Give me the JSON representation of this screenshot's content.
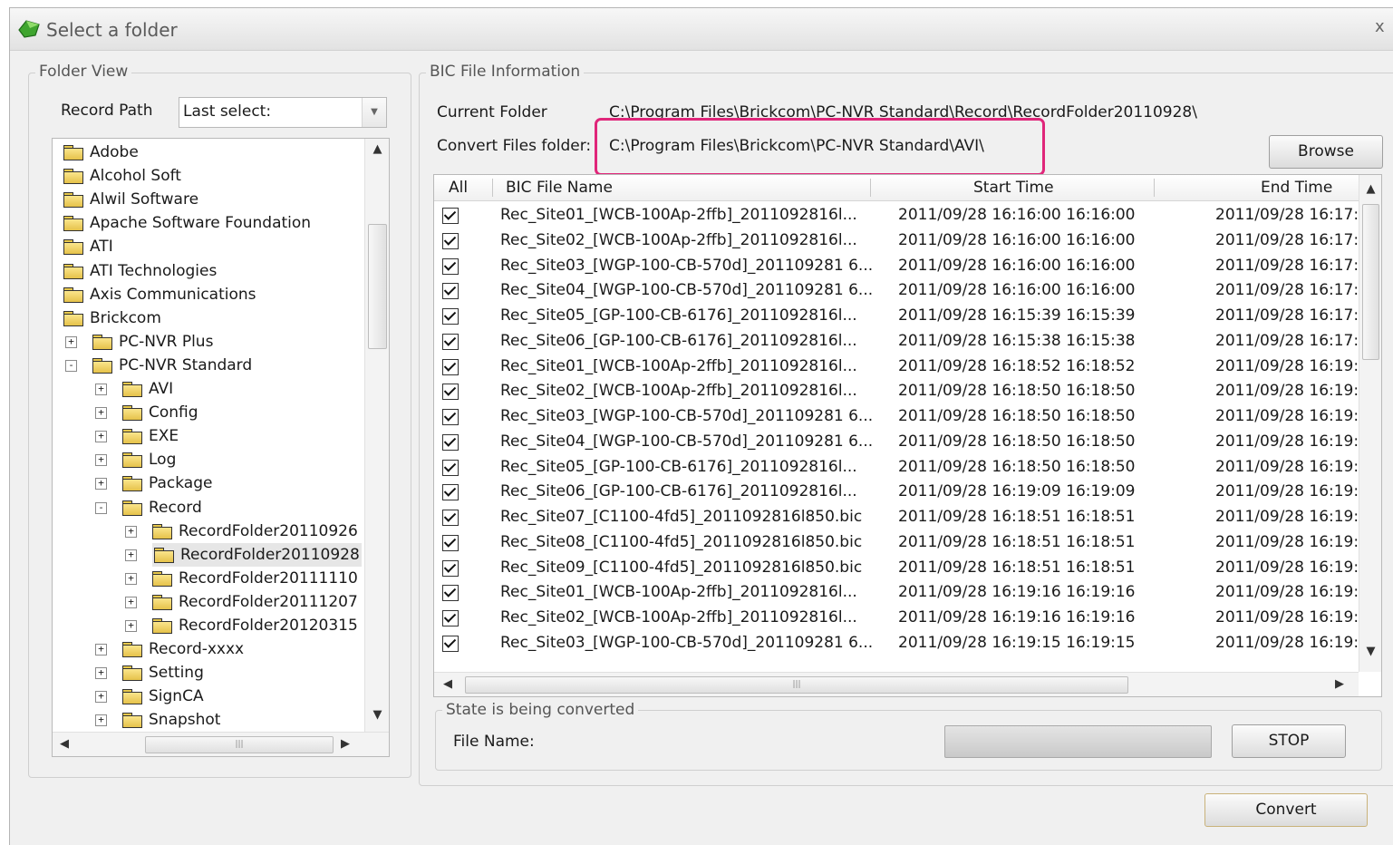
{
  "window": {
    "title": "Select a folder",
    "close_glyph": "x"
  },
  "folder_view": {
    "legend": "Folder View",
    "record_path_label": "Record Path",
    "record_path_value": "Last select:",
    "tree_items": [
      {
        "label": "Adobe",
        "depth": 0,
        "expander": ""
      },
      {
        "label": "Alcohol Soft",
        "depth": 0,
        "expander": ""
      },
      {
        "label": "Alwil Software",
        "depth": 0,
        "expander": ""
      },
      {
        "label": "Apache Software Foundation",
        "depth": 0,
        "expander": ""
      },
      {
        "label": "ATI",
        "depth": 0,
        "expander": ""
      },
      {
        "label": "ATI Technologies",
        "depth": 0,
        "expander": ""
      },
      {
        "label": "Axis Communications",
        "depth": 0,
        "expander": ""
      },
      {
        "label": "Brickcom",
        "depth": 0,
        "expander": ""
      },
      {
        "label": "PC-NVR Plus",
        "depth": 1,
        "expander": "+"
      },
      {
        "label": "PC-NVR Standard",
        "depth": 1,
        "expander": "-"
      },
      {
        "label": "AVI",
        "depth": 2,
        "expander": "+"
      },
      {
        "label": "Config",
        "depth": 2,
        "expander": "+"
      },
      {
        "label": "EXE",
        "depth": 2,
        "expander": "+"
      },
      {
        "label": "Log",
        "depth": 2,
        "expander": "+"
      },
      {
        "label": "Package",
        "depth": 2,
        "expander": "+"
      },
      {
        "label": "Record",
        "depth": 2,
        "expander": "-"
      },
      {
        "label": "RecordFolder20110926",
        "depth": 3,
        "expander": "+"
      },
      {
        "label": "RecordFolder20110928",
        "depth": 3,
        "expander": "+",
        "selected": true
      },
      {
        "label": "RecordFolder20111110",
        "depth": 3,
        "expander": "+"
      },
      {
        "label": "RecordFolder20111207",
        "depth": 3,
        "expander": "+"
      },
      {
        "label": "RecordFolder20120315",
        "depth": 3,
        "expander": "+"
      },
      {
        "label": "Record-xxxx",
        "depth": 2,
        "expander": "+"
      },
      {
        "label": "Setting",
        "depth": 2,
        "expander": "+"
      },
      {
        "label": "SignCA",
        "depth": 2,
        "expander": "+"
      },
      {
        "label": "Snapshot",
        "depth": 2,
        "expander": "+"
      }
    ]
  },
  "bic_info": {
    "legend": "BIC File Information",
    "current_folder_label": "Current Folder",
    "current_folder_value": "C:\\Program Files\\Brickcom\\PC-NVR Standard\\Record\\RecordFolder20110928\\",
    "convert_folder_label": "Convert Files folder:",
    "convert_folder_value": "C:\\Program Files\\Brickcom\\PC-NVR Standard\\AVI\\",
    "highlight_color": "#e0267a",
    "browse_label": "Browse"
  },
  "file_table": {
    "headers": {
      "all": "All",
      "name": "BIC File Name",
      "start": "Start Time",
      "end": "End Time"
    },
    "rows": [
      {
        "checked": true,
        "name": "Rec_Site01_[WCB-100Ap-2ffb]_2011092816l...",
        "start": "2011/09/28 16:16:00 16:16:00",
        "end": "2011/09/28 16:17:"
      },
      {
        "checked": true,
        "name": "Rec_Site02_[WCB-100Ap-2ffb]_2011092816l...",
        "start": "2011/09/28 16:16:00 16:16:00",
        "end": "2011/09/28 16:17:"
      },
      {
        "checked": true,
        "name": "Rec_Site03_[WGP-100-CB-570d]_201109281 6...",
        "start": "2011/09/28 16:16:00 16:16:00",
        "end": "2011/09/28 16:17:"
      },
      {
        "checked": true,
        "name": "Rec_Site04_[WGP-100-CB-570d]_201109281 6...",
        "start": "2011/09/28 16:16:00 16:16:00",
        "end": "2011/09/28 16:17:"
      },
      {
        "checked": true,
        "name": "Rec_Site05_[GP-100-CB-6176]_2011092816l...",
        "start": "2011/09/28 16:15:39 16:15:39",
        "end": "2011/09/28 16:17:"
      },
      {
        "checked": true,
        "name": "Rec_Site06_[GP-100-CB-6176]_2011092816l...",
        "start": "2011/09/28 16:15:38 16:15:38",
        "end": "2011/09/28 16:17:"
      },
      {
        "checked": true,
        "name": "Rec_Site01_[WCB-100Ap-2ffb]_2011092816l...",
        "start": "2011/09/28 16:18:52 16:18:52",
        "end": "2011/09/28 16:19:"
      },
      {
        "checked": true,
        "name": "Rec_Site02_[WCB-100Ap-2ffb]_2011092816l...",
        "start": "2011/09/28 16:18:50 16:18:50",
        "end": "2011/09/28 16:19:"
      },
      {
        "checked": true,
        "name": "Rec_Site03_[WGP-100-CB-570d]_201109281 6...",
        "start": "2011/09/28 16:18:50 16:18:50",
        "end": "2011/09/28 16:19:"
      },
      {
        "checked": true,
        "name": "Rec_Site04_[WGP-100-CB-570d]_201109281 6...",
        "start": "2011/09/28 16:18:50 16:18:50",
        "end": "2011/09/28 16:19:"
      },
      {
        "checked": true,
        "name": "Rec_Site05_[GP-100-CB-6176]_2011092816l...",
        "start": "2011/09/28 16:18:50 16:18:50",
        "end": "2011/09/28 16:19:"
      },
      {
        "checked": true,
        "name": "Rec_Site06_[GP-100-CB-6176]_2011092816l...",
        "start": "2011/09/28 16:19:09 16:19:09",
        "end": "2011/09/28 16:19:"
      },
      {
        "checked": true,
        "name": "Rec_Site07_[C1100-4fd5]_2011092816l850.bic",
        "start": "2011/09/28 16:18:51 16:18:51",
        "end": "2011/09/28 16:19:"
      },
      {
        "checked": true,
        "name": "Rec_Site08_[C1100-4fd5]_2011092816l850.bic",
        "start": "2011/09/28 16:18:51 16:18:51",
        "end": "2011/09/28 16:19:"
      },
      {
        "checked": true,
        "name": "Rec_Site09_[C1100-4fd5]_2011092816l850.bic",
        "start": "2011/09/28 16:18:51 16:18:51",
        "end": "2011/09/28 16:19:"
      },
      {
        "checked": true,
        "name": "Rec_Site01_[WCB-100Ap-2ffb]_2011092816l...",
        "start": "2011/09/28 16:19:16 16:19:16",
        "end": "2011/09/28 16:19:"
      },
      {
        "checked": true,
        "name": "Rec_Site02_[WCB-100Ap-2ffb]_2011092816l...",
        "start": "2011/09/28 16:19:16 16:19:16",
        "end": "2011/09/28 16:19:"
      },
      {
        "checked": true,
        "name": "Rec_Site03_[WGP-100-CB-570d]_201109281 6...",
        "start": "2011/09/28 16:19:15 16:19:15",
        "end": "2011/09/28 16:19:"
      }
    ]
  },
  "conversion": {
    "legend": "State is being converted",
    "file_name_label": "File Name:",
    "progress": 0,
    "stop_label": "STOP"
  },
  "convert_label": "Convert",
  "icons": {
    "app": "green-gem-icon",
    "folder": "folder-icon",
    "scroll_up": "▲",
    "scroll_down": "▼",
    "scroll_left": "◀",
    "scroll_right": "▶",
    "combo_arrow": "▼",
    "thumb_grip": "|||"
  },
  "colors": {
    "accent": "#e0267a",
    "folder": "#f2d66b",
    "selection": "#e6e6e6"
  }
}
